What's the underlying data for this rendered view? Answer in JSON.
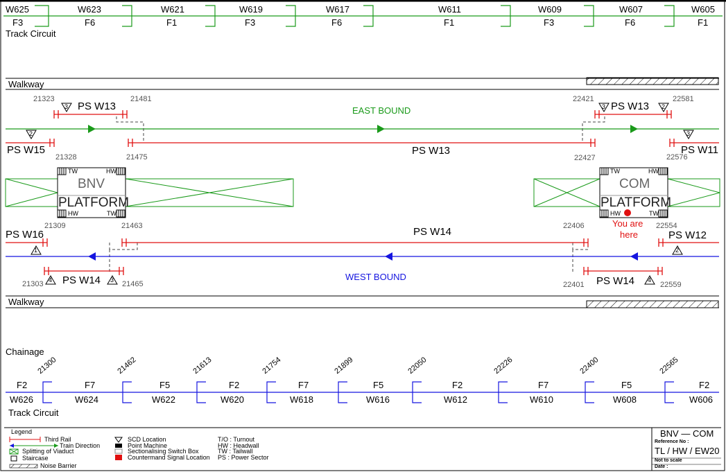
{
  "top_track_circuit": {
    "label": "Track Circuit",
    "circuits": [
      {
        "name": "W625",
        "freq": "F3"
      },
      {
        "name": "W623",
        "freq": "F6"
      },
      {
        "name": "W621",
        "freq": "F1"
      },
      {
        "name": "W619",
        "freq": "F3"
      },
      {
        "name": "W617",
        "freq": "F6"
      },
      {
        "name": "W611",
        "freq": "F1"
      },
      {
        "name": "W609",
        "freq": "F3"
      },
      {
        "name": "W607",
        "freq": "F6"
      },
      {
        "name": "W605",
        "freq": "F1"
      }
    ]
  },
  "walkway_top": "Walkway",
  "walkway_bottom": "Walkway",
  "east_bound": "EAST BOUND",
  "west_bound": "WEST BOUND",
  "power_sectors": {
    "ps_w13_a": "PS  W13",
    "ps_w13_main": "PS  W13",
    "ps_w13_b": "PS  W13",
    "ps_w15": "PS  W15",
    "ps_w11": "PS  W11",
    "ps_w16": "PS  W16",
    "ps_w14_main": "PS  W14",
    "ps_w14_a": "PS  W14",
    "ps_w14_b": "PS  W14",
    "ps_w12": "PS  W12"
  },
  "scd_numbers": {
    "s1": "3",
    "s2": "2",
    "s3": "3",
    "s4": "2",
    "s5": "3",
    "s6": "1",
    "s7": "4",
    "s8": "3",
    "s9": "4",
    "s10": "2"
  },
  "chainage_points": {
    "p21323": "21323",
    "p21481": "21481",
    "p21328": "21328",
    "p21475": "21475",
    "p22421": "22421",
    "p22581": "22581",
    "p22427": "22427",
    "p22576": "22576",
    "p21309": "21309",
    "p21463": "21463",
    "p21303": "21303",
    "p21465": "21465",
    "p22406": "22406",
    "p22554": "22554",
    "p22401": "22401",
    "p22559": "22559"
  },
  "platforms": {
    "bnv_name": "BNV",
    "bnv_label": "PLATFORM",
    "com_name": "COM",
    "com_label": "PLATFORM",
    "tw": "TW",
    "hw": "HW"
  },
  "you_are_here": {
    "line1": "You are",
    "line2": "here"
  },
  "bottom": {
    "chainage_label": "Chainage",
    "chainages": [
      "21300",
      "21462",
      "21613",
      "21754",
      "21899",
      "22050",
      "22226",
      "22400",
      "22565"
    ],
    "track_circuit_label": "Track Circuit",
    "circuits": [
      {
        "name": "W626",
        "freq": "F2"
      },
      {
        "name": "W624",
        "freq": "F7"
      },
      {
        "name": "W622",
        "freq": "F5"
      },
      {
        "name": "W620",
        "freq": "F2"
      },
      {
        "name": "W618",
        "freq": "F7"
      },
      {
        "name": "W616",
        "freq": "F5"
      },
      {
        "name": "W612",
        "freq": "F2"
      },
      {
        "name": "W610",
        "freq": "F7"
      },
      {
        "name": "W608",
        "freq": "F5"
      },
      {
        "name": "W606",
        "freq": "F2"
      }
    ]
  },
  "legend": {
    "title": "Legend",
    "third_rail": "Third Rail",
    "train_direction": "Train Direction",
    "splitting": "Splitting of Viaduct",
    "staircase": "Staircase",
    "noise_barrier": "Noise Barrier",
    "scd_location": "SCD Location",
    "point_machine": "Point Machine",
    "ssb": "Sectionalising Switch Box",
    "countermand": "Countermand Signal Location",
    "abbr1": "T/O : Turnout",
    "abbr2": "HW : Headwall",
    "abbr3": "TW : Tailwall",
    "abbr4": "PS : Power Sector"
  },
  "title_block": {
    "title": "BNV  —  COM",
    "ref_label": "Reference No :",
    "ref": "TL  /  HW  /  EW20",
    "scale": "Not to scale",
    "date": "Date :"
  },
  "colors": {
    "green": "#1a9a1a",
    "red": "#e01010",
    "blue": "#1515e0"
  }
}
